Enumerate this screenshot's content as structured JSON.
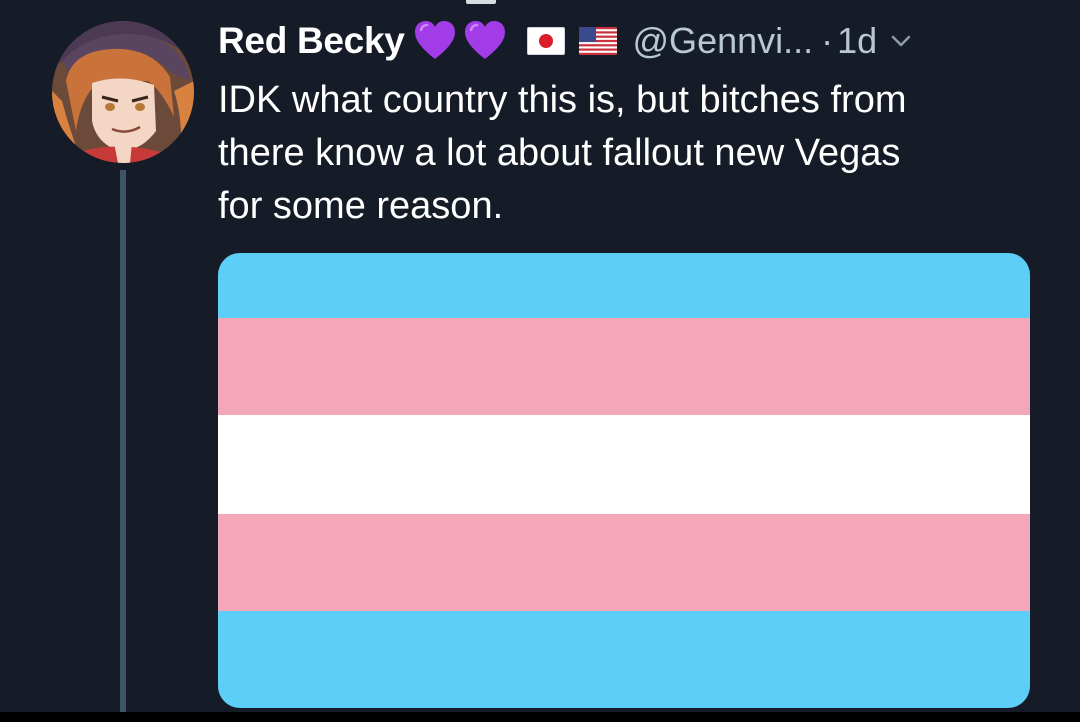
{
  "tweet": {
    "author_name": "Red Becky",
    "emojis": [
      "purple-heart",
      "purple-heart",
      "flag-japan",
      "flag-united-states"
    ],
    "handle": "@Gennvi...",
    "separator": "·",
    "time": "1d",
    "text": "IDK what country this is, but bitches from\nthere know a lot about fallout new Vegas\nfor some reason."
  },
  "media": {
    "type": "image",
    "description_icon": "transgender-pride-flag",
    "stripes": [
      "#5ccef8",
      "#f4a7b9",
      "#ffffff",
      "#f4a7b9",
      "#5ccef8"
    ]
  },
  "colors": {
    "background": "#151c27",
    "secondary_text": "#b9c6d3",
    "thread_line": "#3d5366",
    "heart": "#a23be8"
  }
}
